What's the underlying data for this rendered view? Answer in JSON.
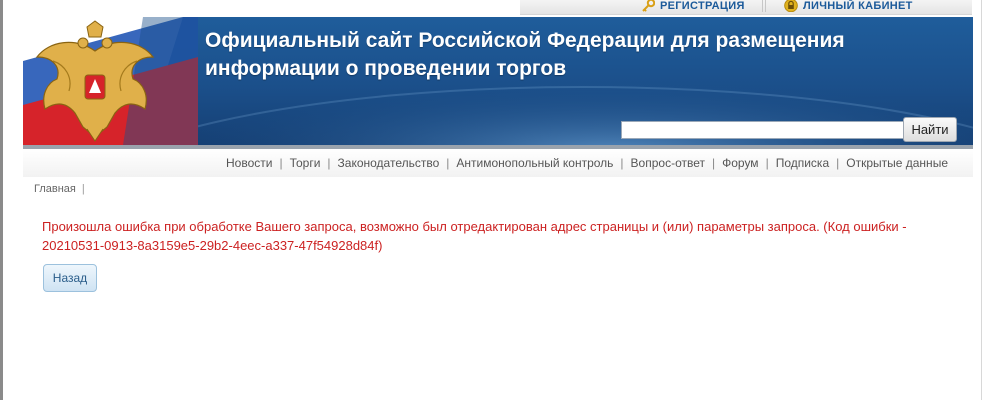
{
  "top_links": [
    {
      "label": "РЕГИСТРАЦИЯ",
      "icon": "key-icon"
    },
    {
      "label": "ЛИЧНЫЙ КАБИНЕТ",
      "icon": "lock-icon"
    }
  ],
  "header": {
    "title_line1": "Официальный сайт Российской Федерации для размещения",
    "title_line2": "информации о проведении торгов",
    "logo": "russian-coat-of-arms",
    "search_value": "",
    "search_button": "Найти"
  },
  "nav": {
    "items": [
      "Новости",
      "Торги",
      "Законодательство",
      "Антимонопольный контроль",
      "Вопрос-ответ",
      "Форум",
      "Подписка",
      "Открытые данные"
    ],
    "separator": "|"
  },
  "breadcrumb": {
    "home": "Главная",
    "separator": "|"
  },
  "error": {
    "message": "Произошла ошибка при обработке Вашего запроса, возможно был отредактирован адрес страницы и (или) параметры запроса. (Код ошибки - 20210531-0913-8a3159e5-29b2-4eec-a337-47f54928d84f)"
  },
  "back_button": "Назад",
  "colors": {
    "banner": "#1b4f8a",
    "title_text": "#ffffff",
    "error_text": "#cc2222",
    "link": "#1b5a9a",
    "flag_white": "#ffffff",
    "flag_blue": "#2256b5",
    "flag_red": "#d6232a"
  }
}
